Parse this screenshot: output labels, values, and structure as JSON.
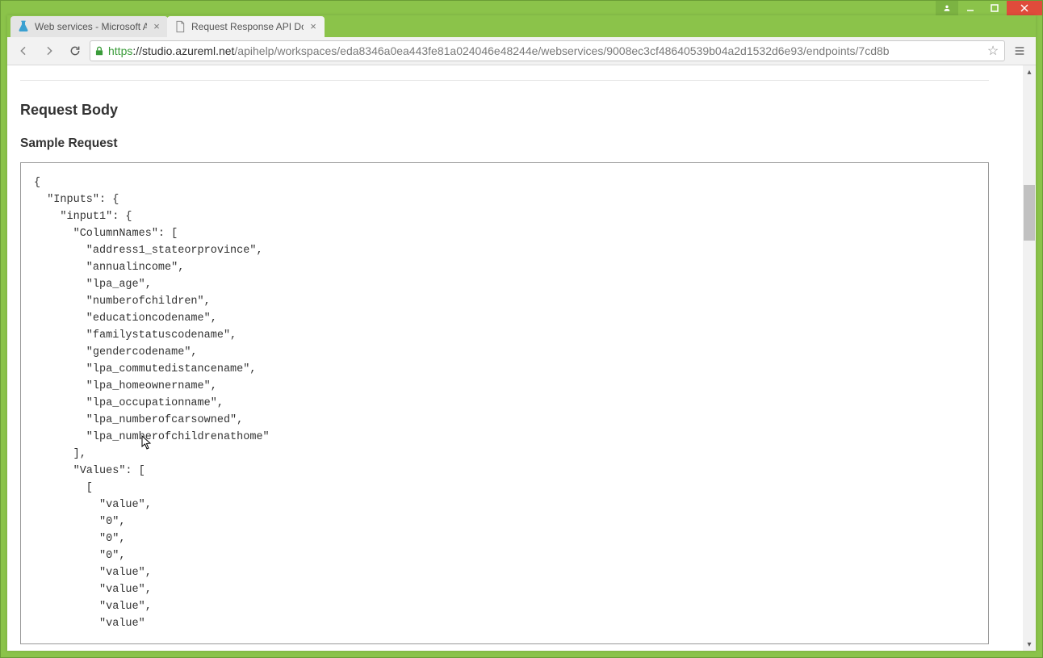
{
  "window": {
    "tabs": [
      {
        "title": "Web services - Microsoft A",
        "favicon": "flask"
      },
      {
        "title": "Request Response API Do",
        "favicon": "page"
      }
    ],
    "active_tab_index": 1
  },
  "toolbar": {
    "url_scheme": "https",
    "url_host": "://studio.azureml.net",
    "url_path": "/apihelp/workspaces/eda8346a0ea443fe81a024046e48244e/webservices/9008ec3cf48640539b04a2d1532d6e93/endpoints/7cd8b"
  },
  "page": {
    "heading_request_body": "Request Body",
    "heading_sample_request": "Sample Request",
    "sample_json": {
      "Inputs": {
        "input1": {
          "ColumnNames": [
            "address1_stateorprovince",
            "annualincome",
            "lpa_age",
            "numberofchildren",
            "educationcodename",
            "familystatuscodename",
            "gendercodename",
            "lpa_commutedistancename",
            "lpa_homeownername",
            "lpa_occupationname",
            "lpa_numberofcarsowned",
            "lpa_numberofchildrenathome"
          ],
          "Values": [
            [
              "value",
              "0",
              "0",
              "0",
              "value",
              "value",
              "value",
              "value"
            ]
          ]
        }
      }
    }
  },
  "scrollbar": {
    "thumb_top_pct": 19,
    "thumb_height_pct": 10
  }
}
